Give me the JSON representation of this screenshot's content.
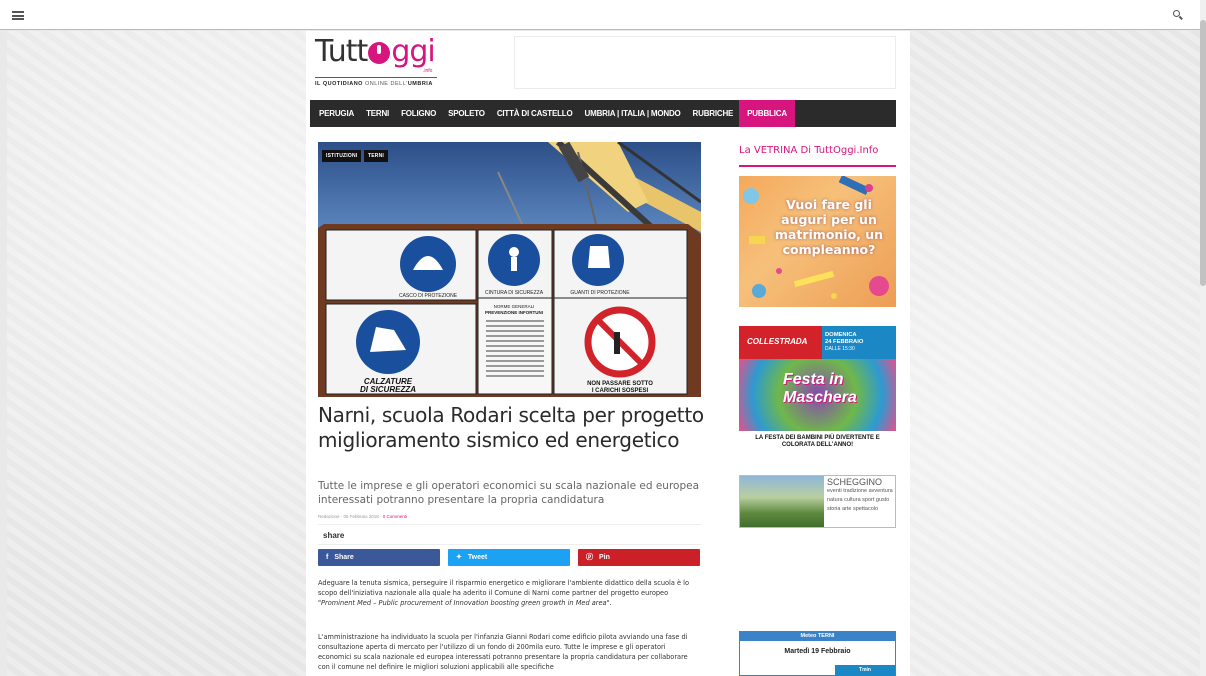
{
  "site": {
    "logo_main": "Tutt",
    "logo_accent": "ggi",
    "logo_suffix": ".info",
    "tagline_bold1": "IL QUOTIDIANO",
    "tagline_mid": " ONLINE DELL'",
    "tagline_bold2": "UMBRIA"
  },
  "nav": {
    "items": [
      "PERUGIA",
      "TERNI",
      "FOLIGNO",
      "SPOLETO",
      "CITTÀ DI CASTELLO",
      "UMBRIA | ITALIA | MONDO",
      "RUBRICHE",
      "PUBBLICA"
    ]
  },
  "article": {
    "tags": [
      "ISTITUZIONI",
      "TERNI"
    ],
    "title": "Narni, scuola Rodari scelta per progetto miglioramento sismico ed energetico",
    "subtitle": "Tutte le imprese e gli operatori economici su scala nazionale ed europea interessati potranno presentare la propria candidatura",
    "author": "Redazione",
    "date": "06 Febbraio 2018",
    "comments": "0 Commenti",
    "share_label": "share",
    "share_buttons": [
      {
        "label": "Share",
        "icon": "f",
        "color": "#3b5998"
      },
      {
        "label": "Tweet",
        "icon": "t",
        "color": "#1da1f2"
      },
      {
        "label": "Pin",
        "icon": "p",
        "color": "#cb2027"
      }
    ],
    "para1_a": "Adeguare la tenuta sismica, perseguire il risparmio energetico e migliorare l'ambiente didattico della scuola è lo scopo dell'iniziativa nazionale alla quale ha aderito il Comune di Narni come partner del progetto europeo ",
    "para1_b": "\"Prominent Med – Public procurement of Innovation boosting green growth in Med area\"",
    "para1_c": ".",
    "para2": "L'amministrazione ha individuato la scuola per l'infanzia Gianni Rodari come edificio pilota avviando una fase di consultazione aperta di mercato per l'utilizzo di un fondo di 200mila euro. Tutte le imprese e gli operatori economici su scala nazionale ed europea interessati potranno presentare la propria candidatura per collaborare con il comune nel definire le migliori soluzioni applicabili alle specifiche"
  },
  "hero_signs": {
    "top": [
      "CASCO DI PROTEZIONE",
      "CINTURA DI SICUREZZA",
      "GUANTI DI PROTEZIONE"
    ],
    "center": [
      "NORME GENERALI",
      "PREVENZIONE INFORTUNI"
    ],
    "bottom_left": [
      "CALZATURE",
      "DI SICUREZZA"
    ],
    "bottom_right": [
      "NON PASSARE SOTTO",
      "I CARICHI SOSPESI"
    ]
  },
  "sidebar": {
    "title": "La VETRINA Di TuttOggi.Info",
    "promo1": "Vuoi fare gli auguri per un matrimonio, un compleanno?",
    "promo2": {
      "brand": "COLLESTRADA",
      "day": "DOMENICA",
      "date": "24 FEBBRAIO",
      "time": "DALLE 15:30",
      "festa": "Festa in Maschera",
      "footer": "LA FESTA DEI BAMBINI PIÙ DIVERTENTE E COLORATA DELL'ANNO!"
    },
    "promo3": {
      "name": "SCHEGGINO",
      "words": "eventi tradizione avventura natura cultura sport gusto storia arte spettacolo"
    },
    "meteo": {
      "header": "Meteo TERNI",
      "day": "Martedì 19 Febbraio",
      "tab": "Tmin"
    }
  },
  "colors": {
    "brand": "#d6157e",
    "nav_bg": "#2b2b2b",
    "facebook": "#3b5998",
    "twitter": "#1da1f2",
    "pinterest": "#cb2027"
  }
}
